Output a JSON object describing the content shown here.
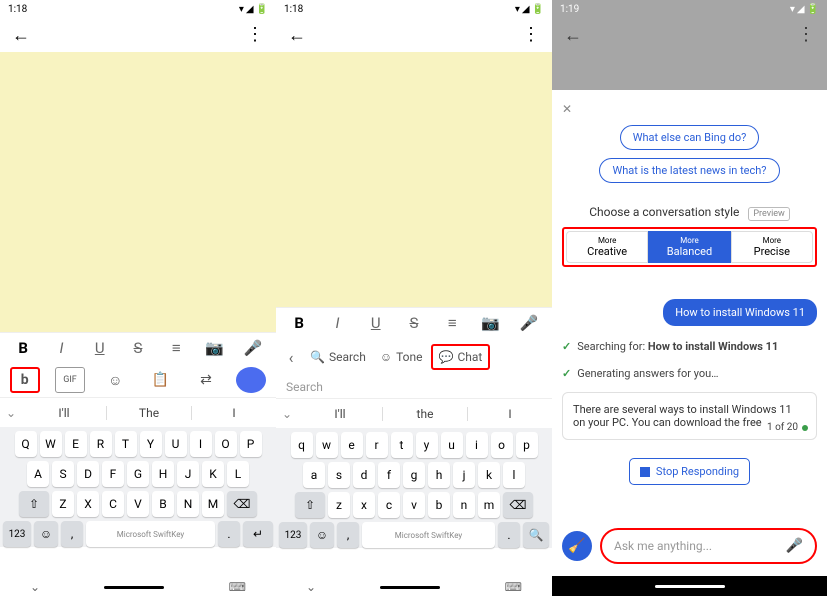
{
  "panel1": {
    "time": "1:18",
    "status_icons": [
      "▾",
      "◢",
      "🔋"
    ],
    "format_icons": {
      "bold": "B",
      "italic": "I",
      "underline": "U",
      "strike": "S",
      "list": "≡",
      "camera": "📷",
      "mic": "🎤"
    },
    "tools": {
      "bing": "b",
      "gif": "GIF",
      "sticker": "☺",
      "clipboard": "📋",
      "translate": "⇄",
      "settings": "◉"
    },
    "predictions": {
      "p1": "I'll",
      "p2": "The",
      "p3": "I"
    },
    "keyboard": {
      "r1": [
        "Q",
        "W",
        "E",
        "R",
        "T",
        "Y",
        "U",
        "I",
        "O",
        "P"
      ],
      "r2": [
        "A",
        "S",
        "D",
        "F",
        "G",
        "H",
        "J",
        "K",
        "L"
      ],
      "r3_shift": "⇧",
      "r3": [
        "Z",
        "X",
        "C",
        "V",
        "B",
        "N",
        "M"
      ],
      "r3_del": "⌫",
      "num": "123",
      "emoji": "☺",
      "comma": ",",
      "space": "Microsoft SwiftKey",
      "period": ".",
      "enter": "↵"
    }
  },
  "panel2": {
    "time": "1:18",
    "ai_row": {
      "search": "Search",
      "tone": "Tone",
      "chat": "Chat"
    },
    "search_placeholder": "Search",
    "predictions": {
      "p1": "I'll",
      "p2": "the",
      "p3": "I"
    },
    "keyboard": {
      "r1": [
        "q",
        "w",
        "e",
        "r",
        "t",
        "y",
        "u",
        "i",
        "o",
        "p"
      ],
      "r2": [
        "a",
        "s",
        "d",
        "f",
        "g",
        "h",
        "j",
        "k",
        "l"
      ],
      "r3_shift": "⇧",
      "r3": [
        "z",
        "x",
        "c",
        "v",
        "b",
        "n",
        "m"
      ],
      "r3_del": "⌫",
      "num": "123",
      "emoji": "☺",
      "comma": ",",
      "space": "Microsoft SwiftKey",
      "period": ".",
      "search": "🔍"
    }
  },
  "panel3": {
    "time": "1:19",
    "chips": {
      "c1": "What else can Bing do?",
      "c2": "What is the latest news in tech?"
    },
    "style_label": "Choose a conversation style",
    "preview": "Preview",
    "styles": {
      "creative": {
        "s1": "More",
        "s2": "Creative"
      },
      "balanced": {
        "s1": "More",
        "s2": "Balanced"
      },
      "precise": {
        "s1": "More",
        "s2": "Precise"
      }
    },
    "user_msg": "How to install Windows 11",
    "searching_prefix": "Searching for: ",
    "searching_q": "How to install Windows 11",
    "generating": "Generating answers for you…",
    "answer": "There are several ways to install Windows 11 on your PC. You can download the free",
    "count": "1 of 20",
    "stop": "Stop Responding",
    "ask_placeholder": "Ask me anything..."
  }
}
